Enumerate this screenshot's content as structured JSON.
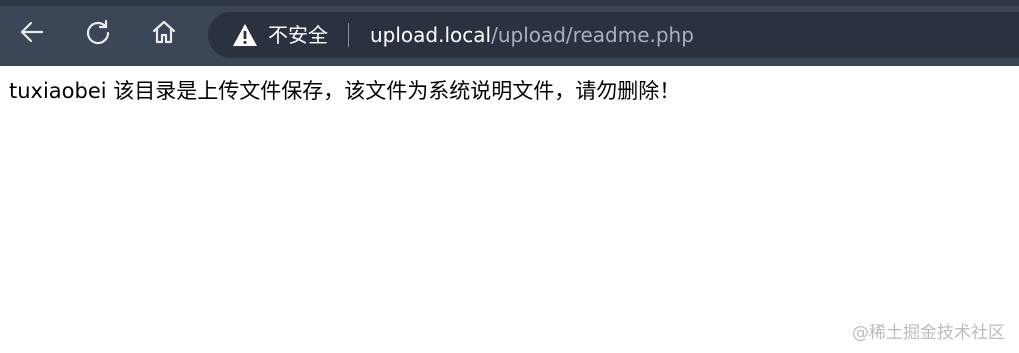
{
  "browser": {
    "security_label": "不安全",
    "url_host": "upload.local",
    "url_path": "/upload/readme.php",
    "icons": {
      "back": "back-arrow-icon",
      "reload": "reload-icon",
      "home": "home-icon",
      "security": "warning-icon"
    }
  },
  "page": {
    "text": "tuxiaobei 该目录是上传文件保存，该文件为系统说明文件，请勿删除！"
  },
  "watermark": {
    "text": "@稀土掘金技术社区"
  }
}
